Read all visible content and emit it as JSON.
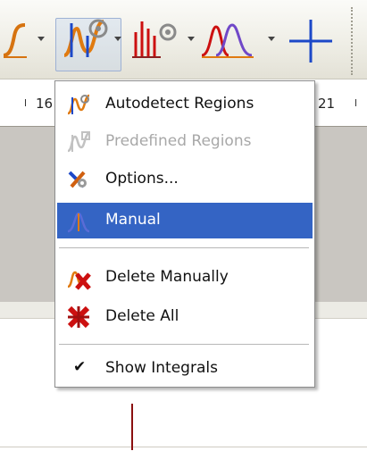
{
  "toolbar": {
    "buttons": [
      {
        "name": "integral-icon"
      },
      {
        "name": "autodetect-regions-icon"
      },
      {
        "name": "multiplet-icon"
      },
      {
        "name": "peak-fitting-icon"
      },
      {
        "name": "cursor-crosshair-icon"
      }
    ]
  },
  "ruler": {
    "left_label": "16",
    "right_label": "21"
  },
  "menu": {
    "items": [
      {
        "label": "Autodetect Regions",
        "icon": "autodetect-regions-icon",
        "state": "enabled"
      },
      {
        "label": "Predefined Regions",
        "icon": "predefined-regions-icon",
        "state": "disabled"
      },
      {
        "label": "Options...",
        "icon": "options-icon",
        "state": "enabled"
      },
      {
        "label": "Manual",
        "icon": "manual-icon",
        "state": "selected"
      },
      {
        "label": "Delete Manually",
        "icon": "delete-manually-icon",
        "state": "enabled"
      },
      {
        "label": "Delete All",
        "icon": "delete-all-icon",
        "state": "enabled"
      },
      {
        "label": "Show Integrals",
        "icon": "checkmark-icon",
        "state": "checked"
      }
    ]
  },
  "colors": {
    "accent": "#3464c4",
    "peak": "#8b1010",
    "panel": "#c9c6c1",
    "icon_orange": "#e07a10",
    "icon_red": "#cc1010",
    "icon_blue": "#1c48c8",
    "icon_purple": "#7048c8"
  }
}
